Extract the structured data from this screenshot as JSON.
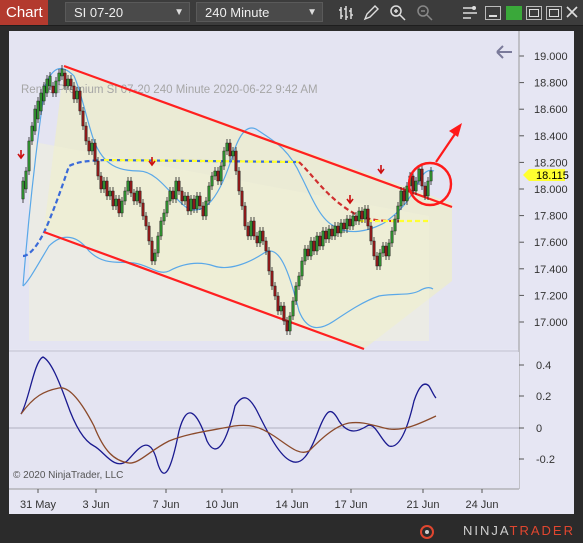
{
  "toolbar": {
    "chart_tab": "Chart",
    "instrument": "SI 07-20",
    "interval": "240 Minute"
  },
  "chart": {
    "watermark": "Renko Premium  SI 07-20  240 Minute  2020-06-22 9:42 AM",
    "copyright": "© 2020 NinjaTrader, LLC",
    "price_label": "18.115",
    "price_axis_ticks": [
      "19.000",
      "18.800",
      "18.600",
      "18.400",
      "18.200",
      "18.000",
      "17.800",
      "17.600",
      "17.400",
      "17.200",
      "17.000"
    ],
    "indicator_axis_ticks": [
      "0.4",
      "0.2",
      "0",
      "-0.2"
    ],
    "date_ticks": [
      "31 May",
      "3 Jun",
      "7 Jun",
      "10 Jun",
      "14 Jun",
      "17 Jun",
      "21 Jun",
      "24 Jun"
    ],
    "colors": {
      "up_candle": "#2f8a2f",
      "down_candle": "#8a1a1a",
      "channel": "#ff2020",
      "bands": "#5aa8e8",
      "midline": "#ffff30",
      "osc_fast": "#1a1a90",
      "osc_slow": "#8b4a2b"
    }
  },
  "brand": {
    "part1": "NINJA",
    "part2": "TRADER"
  }
}
